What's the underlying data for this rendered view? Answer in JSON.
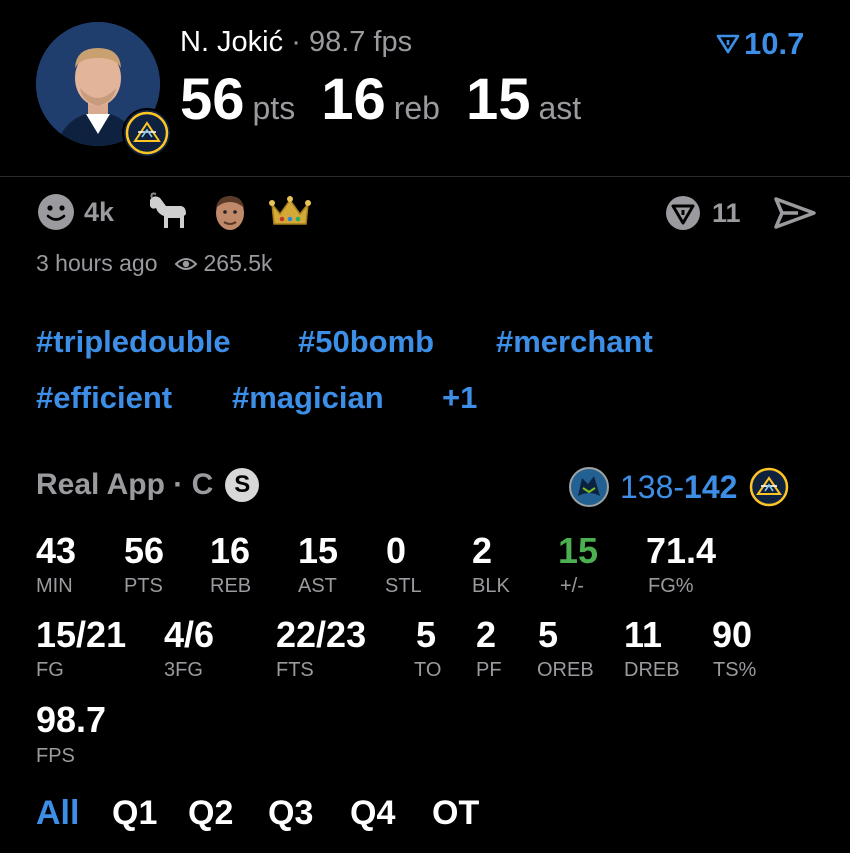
{
  "header": {
    "player_name": "N. Jokić",
    "separator": "·",
    "fps_text": "98.7 fps",
    "rank_value": "10.7",
    "points": "56",
    "points_unit": "pts",
    "rebounds": "16",
    "rebounds_unit": "reb",
    "assists": "15",
    "assists_unit": "ast"
  },
  "reactions": {
    "count": "4k",
    "comment_count": "11",
    "time_ago": "3 hours ago",
    "views": "265.5k",
    "icons": [
      "smiley-icon",
      "goat-icon",
      "player-face-icon",
      "crown-icon"
    ]
  },
  "tags": [
    "#tripledouble",
    "#50bomb",
    "#merchant",
    "#efficient",
    "#magician",
    "+1"
  ],
  "game": {
    "source": "Real App · C",
    "badge": "S",
    "score_away": "138",
    "score_dash": "-",
    "score_home": "142"
  },
  "stats_row1": [
    {
      "value": "43",
      "label": "MIN"
    },
    {
      "value": "56",
      "label": "PTS"
    },
    {
      "value": "16",
      "label": "REB"
    },
    {
      "value": "15",
      "label": "AST"
    },
    {
      "value": "0",
      "label": "STL"
    },
    {
      "value": "2",
      "label": "BLK"
    },
    {
      "value": "15",
      "label": "+/-"
    },
    {
      "value": "71.4",
      "label": "FG%"
    }
  ],
  "stats_row2": [
    {
      "value": "15/21",
      "label": "FG"
    },
    {
      "value": "4/6",
      "label": "3FG"
    },
    {
      "value": "22/23",
      "label": "FTS"
    },
    {
      "value": "5",
      "label": "TO"
    },
    {
      "value": "2",
      "label": "PF"
    },
    {
      "value": "5",
      "label": "OREB"
    },
    {
      "value": "11",
      "label": "DREB"
    },
    {
      "value": "90",
      "label": "TS%"
    }
  ],
  "stats_row3": [
    {
      "value": "98.7",
      "label": "FPS"
    }
  ],
  "periods": [
    "All",
    "Q1",
    "Q2",
    "Q3",
    "Q4",
    "OT"
  ],
  "colors": {
    "accent_blue": "#3d8ee6",
    "positive_green": "#4caf50",
    "gray": "#9a9a9f",
    "nuggets_gold": "#fec524",
    "nuggets_navy": "#0e2240"
  }
}
